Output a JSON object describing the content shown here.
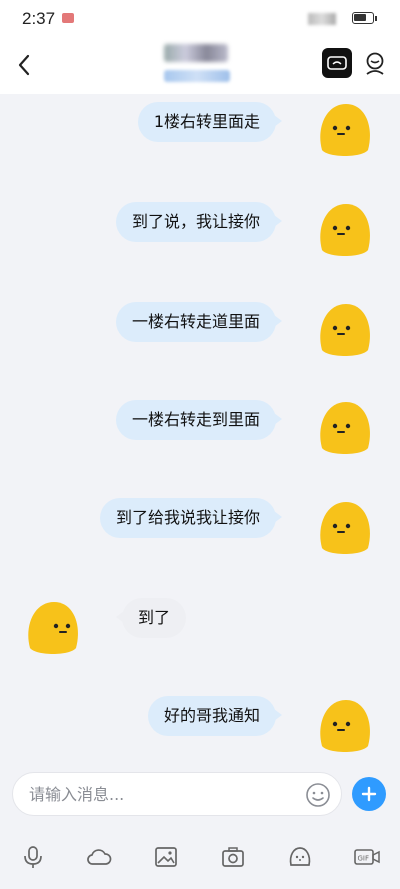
{
  "status_bar": {
    "time": "2:37"
  },
  "header": {
    "back_icon": "chevron-left-icon",
    "title": "",
    "subtitle": "",
    "video_icon": "video-call-icon",
    "profile_icon": "profile-icon"
  },
  "messages": [
    {
      "side": "right",
      "text": "1楼右转里面走"
    },
    {
      "side": "right",
      "text": "到了说，我让接你"
    },
    {
      "side": "right",
      "text": "一楼右转走道里面"
    },
    {
      "side": "right",
      "text": "一楼右转走到里面"
    },
    {
      "side": "right",
      "text": "到了给我说我让接你"
    },
    {
      "side": "left",
      "text": "到了"
    },
    {
      "side": "right",
      "text": "好的哥我通知"
    }
  ],
  "input": {
    "placeholder": "请输入消息..."
  },
  "toolbar": {
    "items": [
      "microphone-icon",
      "cloud-icon",
      "image-icon",
      "camera-icon",
      "emoji-icon",
      "gif-icon"
    ]
  },
  "colors": {
    "bubble_right": "#dcecfb",
    "bubble_left": "#eeeff3",
    "accent": "#2f9bff",
    "avatar_yellow": "#f7c21a"
  }
}
